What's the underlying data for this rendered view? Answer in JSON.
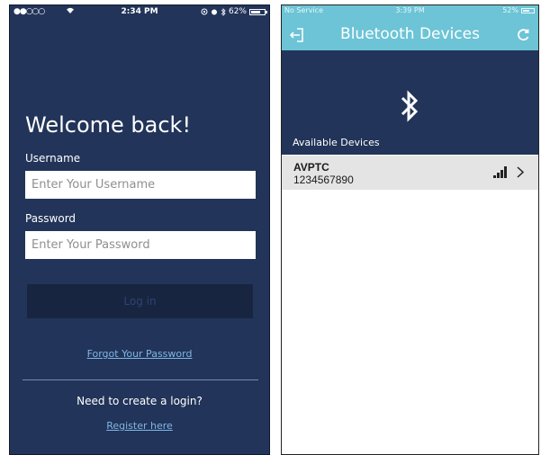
{
  "left_screen": {
    "status_bar": {
      "signal": "●●○○○",
      "time": "2:34 PM",
      "battery_pct": "62%",
      "battery_level": 0.62
    },
    "welcome_title": "Welcome back!",
    "username": {
      "label": "Username",
      "placeholder": "Enter Your Username",
      "value": ""
    },
    "password": {
      "label": "Password",
      "placeholder": "Enter Your Password",
      "value": ""
    },
    "login_button": "Log in",
    "forgot_link": "Forgot Your Password",
    "need_login_text": "Need to create a login?",
    "register_link": "Register here",
    "colors": {
      "background": "#223459",
      "button": "#182541",
      "link": "#7fb6e6"
    }
  },
  "right_screen": {
    "status_bar": {
      "carrier": "No Service",
      "time": "3:39 PM",
      "battery_pct": "52%",
      "battery_level": 0.52
    },
    "header": {
      "title": "Bluetooth Devices",
      "back_icon": "exit-door-icon",
      "refresh_icon": "refresh-icon"
    },
    "panel": {
      "icon": "bluetooth-icon",
      "section_label": "Available Devices"
    },
    "devices": [
      {
        "name": "AVPTC",
        "id": "1234567890",
        "signal_icon": "signal-bars-icon",
        "chevron_icon": "chevron-right-icon"
      }
    ],
    "colors": {
      "header": "#6cc4d6",
      "panel": "#223459",
      "row": "#e4e4e4"
    }
  }
}
